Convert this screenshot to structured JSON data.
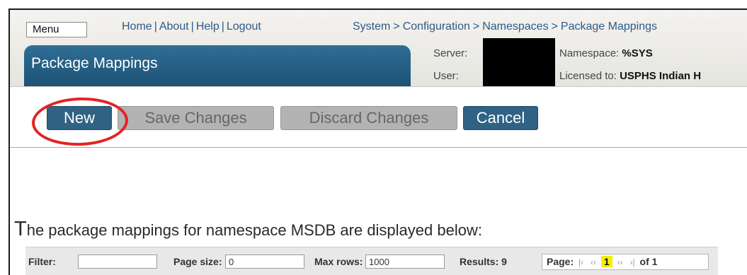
{
  "header": {
    "menu_label": "Menu",
    "links": [
      "Home",
      "About",
      "Help",
      "Logout"
    ],
    "breadcrumb": [
      "System",
      "Configuration",
      "Namespaces",
      "Package Mappings"
    ],
    "breadcrumb_sep": ">",
    "page_title": "Package Mappings",
    "server_label": "Server:",
    "user_label": "User:",
    "namespace_label": "Namespace:",
    "namespace_value": "%SYS",
    "licensed_label": "Licensed to:",
    "licensed_value": "USPHS Indian H"
  },
  "toolbar": {
    "new_label": "New",
    "save_label": "Save Changes",
    "discard_label": "Discard Changes",
    "cancel_label": "Cancel"
  },
  "description": {
    "first_letter": "T",
    "rest": "he package mappings for namespace MSDB are displayed below:"
  },
  "table_nav": {
    "filter_label": "Filter:",
    "filter_value": "",
    "page_size_label": "Page size:",
    "page_size_value": "0",
    "max_rows_label": "Max rows:",
    "max_rows_value": "1000",
    "results_label": "Results: 9",
    "page_label": "Page:",
    "first_glyph": "|‹",
    "prev_glyph": "‹‹",
    "current_page": "1",
    "next_glyph": "››",
    "last_glyph": "›|",
    "of_label": "of 1"
  },
  "colors": {
    "title_tab": "#1d5274",
    "primary_button": "#2f6283",
    "disabled_button": "#b3b3b3",
    "link": "#2d5a8a",
    "highlight_circle": "#e52222",
    "current_page_bg": "#f6f000"
  }
}
